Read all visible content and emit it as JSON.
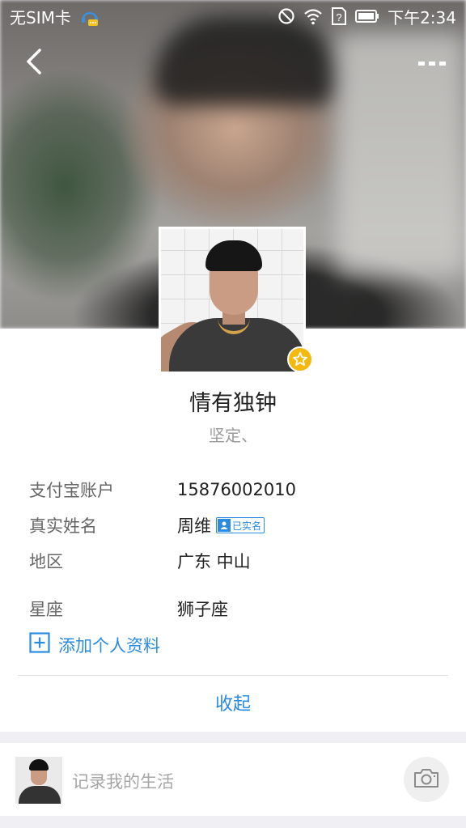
{
  "status_bar": {
    "carrier": "无SIM卡",
    "time": "下午2:34",
    "icons": [
      "assistant-icon",
      "no-disturb-icon",
      "wifi-icon",
      "no-sim-icon",
      "battery-icon"
    ]
  },
  "nav": {
    "back_icon": "chevron-left-icon",
    "more_icon": "more-dots-icon"
  },
  "profile": {
    "nickname": "情有独钟",
    "signature": "坚定、",
    "vip_icon": "star-icon",
    "vip_color": "#f4b90f"
  },
  "info": {
    "rows": [
      {
        "label": "支付宝账户",
        "value": "15876002010"
      },
      {
        "label": "真实姓名",
        "value": "周维",
        "badge": "已实名"
      },
      {
        "label": "地区",
        "value": "广东 中山"
      },
      {
        "label": "星座",
        "value": "狮子座"
      }
    ]
  },
  "actions": {
    "add_profile": "添加个人资料",
    "collapse": "收起"
  },
  "post_bar": {
    "placeholder": "记录我的生活",
    "camera_icon": "camera-icon"
  },
  "colors": {
    "accent": "#2a8be0",
    "background": "#efeff4"
  }
}
